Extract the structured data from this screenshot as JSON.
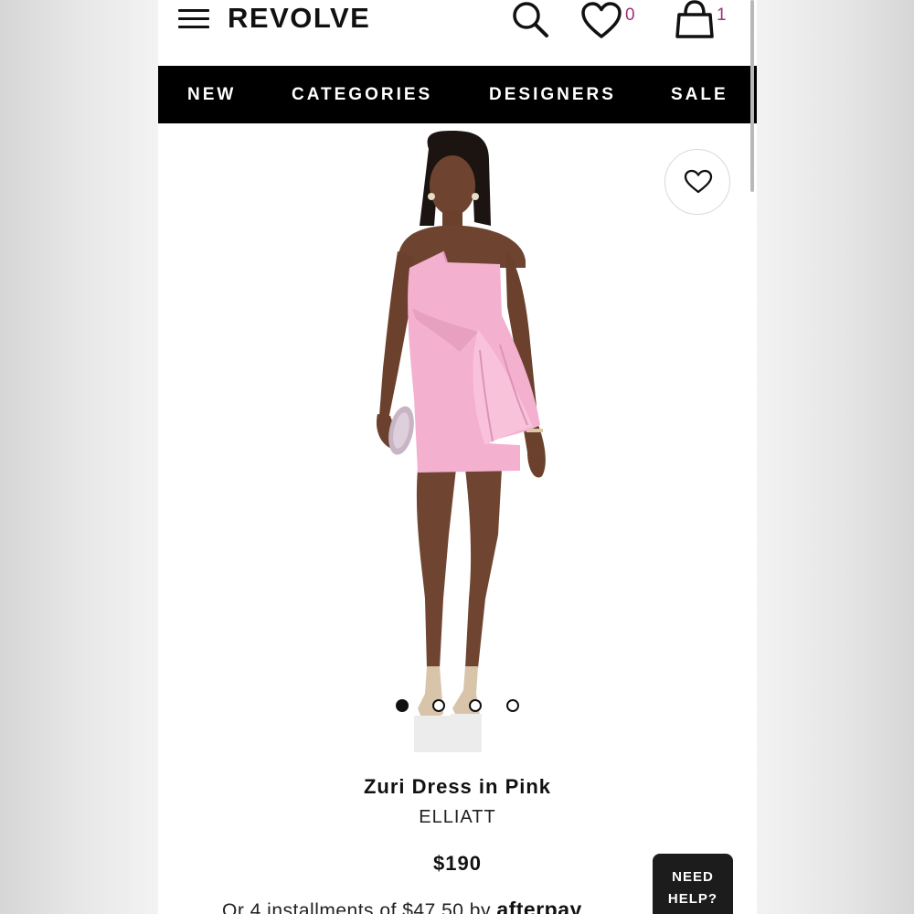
{
  "header": {
    "logo": "REVOLVE",
    "wishlist_count": "0",
    "bag_count": "1",
    "accent_color": "#a2307c"
  },
  "icons": {
    "menu": "menu-icon",
    "search": "search-icon",
    "wishlist": "heart-icon",
    "bag": "shopping-bag-icon",
    "favorite": "heart-icon"
  },
  "nav": {
    "items": [
      {
        "label": "NEW"
      },
      {
        "label": "CATEGORIES"
      },
      {
        "label": "DESIGNERS"
      },
      {
        "label": "SALE"
      }
    ]
  },
  "gallery": {
    "image_count": 4,
    "active_index": 0,
    "dress_color": "#f4b1cf"
  },
  "product": {
    "title": "Zuri Dress in Pink",
    "brand": "ELLIATT",
    "price": "$190",
    "installments_text": "Or 4 installments of $47.50 by ",
    "afterpay_label": "afterpay"
  },
  "help": {
    "line1": "NEED",
    "line2": "HELP?"
  }
}
